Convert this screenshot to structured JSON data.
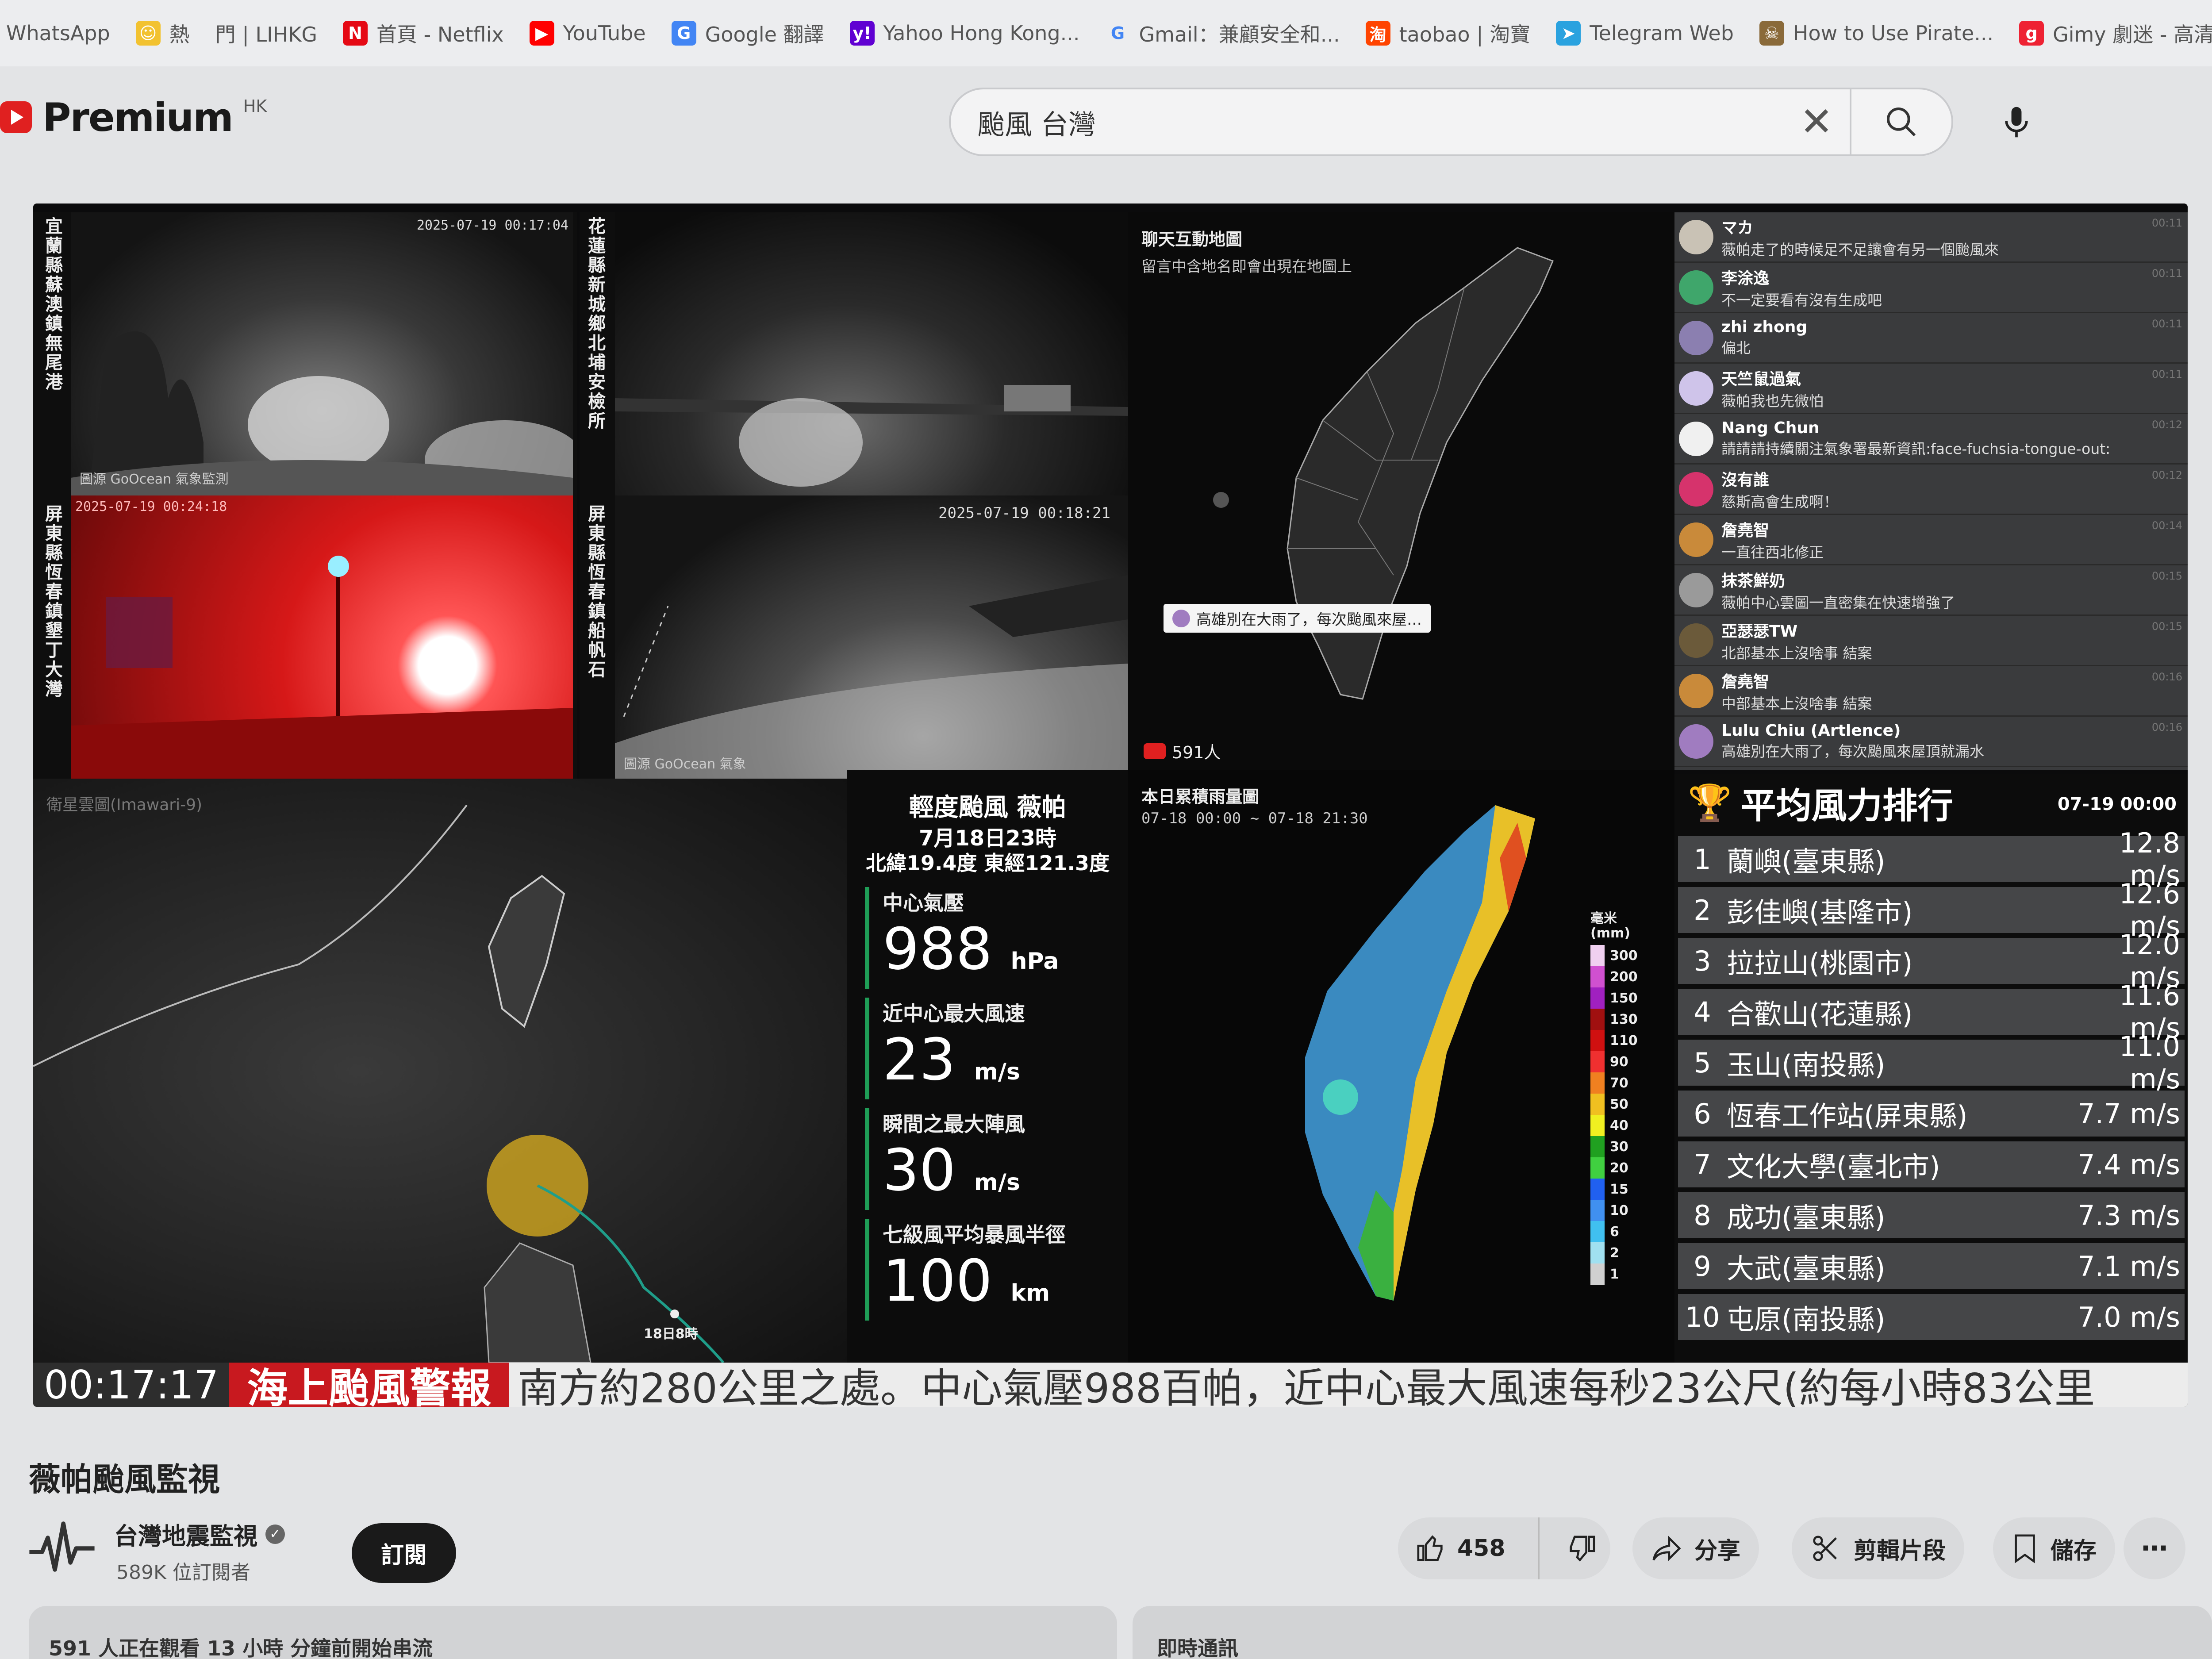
{
  "bookmarks": [
    {
      "label": "WhatsApp",
      "icon": "whatsapp-icon"
    },
    {
      "label": "熱",
      "icon": "smiley-icon"
    },
    {
      "label": "門 | LIHKG",
      "icon": "lihkg-icon"
    },
    {
      "label": "首頁 - Netflix",
      "icon": "netflix-icon"
    },
    {
      "label": "YouTube",
      "icon": "youtube-icon"
    },
    {
      "label": "Google 翻譯",
      "icon": "google-translate-icon"
    },
    {
      "label": "Yahoo Hong Kong...",
      "icon": "yahoo-icon"
    },
    {
      "label": "Gmail：兼顧安全和...",
      "icon": "google-icon"
    },
    {
      "label": "taobao | 淘寶",
      "icon": "taobao-icon"
    },
    {
      "label": "Telegram Web",
      "icon": "telegram-icon"
    },
    {
      "label": "How to Use Pirate...",
      "icon": "pirate-icon"
    },
    {
      "label": "Gimy 劇迷 - 高清線",
      "icon": "gimy-icon"
    }
  ],
  "header": {
    "logo_text": "Premium",
    "region": "HK"
  },
  "search": {
    "value": "颱風 台灣"
  },
  "video": {
    "cams": {
      "cam1": {
        "location": "宜蘭縣蘇澳鎮無尾港",
        "timestamp": "2025-07-19 00:17:04",
        "watermark": "圖源 GoOcean 氣象監測"
      },
      "cam2": {
        "location": "花蓮縣新城鄉北埔安檢所"
      },
      "cam3": {
        "location": "屏東縣恆春鎮墾丁大灣",
        "timestamp": "2025-07-19 00:24:18"
      },
      "cam4": {
        "location": "屏東縣恆春鎮船帆石",
        "timestamp": "2025-07-19 00:18:21",
        "watermark": "圖源 GoOcean 氣象"
      }
    },
    "map": {
      "title": "聊天互動地圖",
      "subtitle": "留言中含地名即會出現在地圖上",
      "bubble": "高雄別在大雨了，每次颱風來屋…",
      "viewers": "591人"
    },
    "chat": [
      {
        "name": "マカ",
        "msg": "薇帕走了的時候足不足讓會有另一個颱風來",
        "time": "00:11",
        "color": "#c9c2b5"
      },
      {
        "name": "李涂逸",
        "msg": "不一定要看有沒有生成吧",
        "time": "00:11",
        "color": "#3fa66b"
      },
      {
        "name": "zhi zhong",
        "msg": "偏北",
        "time": "00:11",
        "color": "#8b7fb0"
      },
      {
        "name": "天竺鼠過氣",
        "msg": "薇帕我也先微怕",
        "time": "00:11",
        "color": "#cfc4ea"
      },
      {
        "name": "Nang Chun",
        "msg": "請請請持續關注氣象署最新資訊:face-fuchsia-tongue-out:",
        "time": "00:12",
        "color": "#f0f0f0"
      },
      {
        "name": "沒有誰",
        "msg": "慈斯高會生成啊！",
        "time": "00:12",
        "color": "#d6336c"
      },
      {
        "name": "詹堯智",
        "msg": "一直往西北修正",
        "time": "00:14",
        "color": "#c98a3a"
      },
      {
        "name": "抹茶鮮奶",
        "msg": "薇帕中心雲圖一直密集在快速增強了",
        "time": "00:15",
        "color": "#9a9a9a"
      },
      {
        "name": "亞瑟瑟TW",
        "msg": "北部基本上沒啥事 結案",
        "time": "00:15",
        "color": "#6b5a3a"
      },
      {
        "name": "詹堯智",
        "msg": "中部基本上沒啥事 結案",
        "time": "00:16",
        "color": "#c98a3a"
      },
      {
        "name": "Lulu Chiu (Artlence)",
        "msg": "高雄別在大雨了，每次颱風來屋頂就漏水",
        "time": "00:16",
        "color": "#a07cc0"
      }
    ],
    "satellite": {
      "label": "衛星雲圖(Imawari-9)",
      "track_label": "18日8時"
    },
    "typhoon": {
      "name": "輕度颱風 薇帕",
      "date": "7月18日23時",
      "position": "北緯19.4度 東經121.3度",
      "items": [
        {
          "label": "中心氣壓",
          "value": "988",
          "unit": "hPa"
        },
        {
          "label": "近中心最大風速",
          "value": "23",
          "unit": "m/s"
        },
        {
          "label": "瞬間之最大陣風",
          "value": "30",
          "unit": "m/s"
        },
        {
          "label": "七級風平均暴風半徑",
          "value": "100",
          "unit": "km"
        }
      ]
    },
    "rain": {
      "title": "本日累積雨量圖",
      "range": "07-18 00:00 ~ 07-18 21:30",
      "legend_title": "毫米\n(mm)",
      "legend": [
        {
          "v": "300",
          "c": "#f0d0f0"
        },
        {
          "v": "200",
          "c": "#d050d0"
        },
        {
          "v": "150",
          "c": "#a020c0"
        },
        {
          "v": "130",
          "c": "#a01010"
        },
        {
          "v": "110",
          "c": "#d01010"
        },
        {
          "v": "90",
          "c": "#f03030"
        },
        {
          "v": "70",
          "c": "#f08020"
        },
        {
          "v": "50",
          "c": "#f0c020"
        },
        {
          "v": "40",
          "c": "#f0f020"
        },
        {
          "v": "30",
          "c": "#20a020"
        },
        {
          "v": "20",
          "c": "#40d040"
        },
        {
          "v": "15",
          "c": "#2060f0"
        },
        {
          "v": "10",
          "c": "#4090f0"
        },
        {
          "v": "6",
          "c": "#40c0f0"
        },
        {
          "v": "2",
          "c": "#a0e0f0"
        },
        {
          "v": "1",
          "c": "#d0d0d0"
        }
      ]
    },
    "wind": {
      "title": "平均風力排行",
      "time": "07-19 00:00",
      "rows": [
        {
          "rank": "1",
          "name": "蘭嶼(臺東縣)",
          "value": "12.8 m/s"
        },
        {
          "rank": "2",
          "name": "彭佳嶼(基隆市)",
          "value": "12.6 m/s"
        },
        {
          "rank": "3",
          "name": "拉拉山(桃園市)",
          "value": "12.0 m/s"
        },
        {
          "rank": "4",
          "name": "合歡山(花蓮縣)",
          "value": "11.6 m/s"
        },
        {
          "rank": "5",
          "name": "玉山(南投縣)",
          "value": "11.0 m/s"
        },
        {
          "rank": "6",
          "name": "恆春工作站(屏東縣)",
          "value": "7.7 m/s"
        },
        {
          "rank": "7",
          "name": "文化大學(臺北市)",
          "value": "7.4 m/s"
        },
        {
          "rank": "8",
          "name": "成功(臺東縣)",
          "value": "7.3 m/s"
        },
        {
          "rank": "9",
          "name": "大武(臺東縣)",
          "value": "7.1 m/s"
        },
        {
          "rank": "10",
          "name": "屯原(南投縣)",
          "value": "7.0 m/s"
        }
      ]
    },
    "ticker": {
      "time": "00:17:17",
      "label": "海上颱風警報",
      "text": "南方約280公里之處。中心氣壓988百帕，近中心最大風速每秒23公尺(約每小時83公里"
    }
  },
  "below": {
    "title": "薇帕颱風監視",
    "channel_name": "台灣地震監視",
    "subscribers": "589K 位訂閱者",
    "subscribe": "訂閱",
    "likes": "458",
    "share": "分享",
    "clip": "剪輯片段",
    "save": "儲存",
    "watching": "591 人正在觀看  13 小時 分鐘前開始串流",
    "live_chat": "即時通訊"
  },
  "colors": {
    "accent_red": "#c8191f",
    "typhoon_green": "#1f9e57",
    "youtube_red": "#e02020"
  }
}
